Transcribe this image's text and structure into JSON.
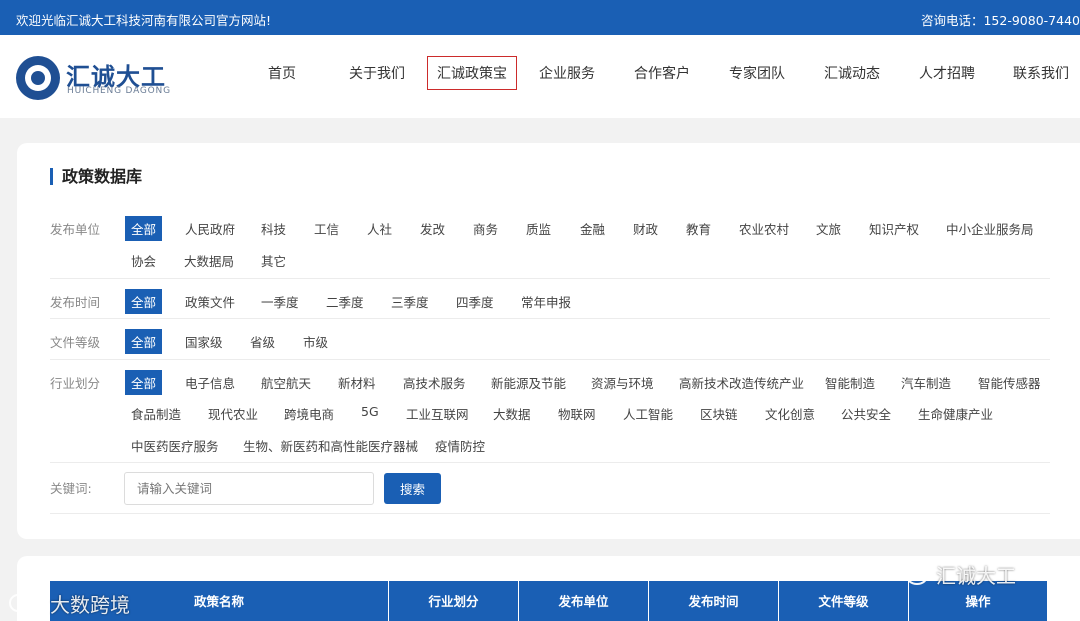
{
  "topbar": {
    "welcome": "欢迎光临汇诚大工科技河南有限公司官方网站!",
    "phone": "咨询电话：152-9080-7440"
  },
  "logo": {
    "name_cn": "汇诚大工",
    "name_en": "HUICHENG DAGONG"
  },
  "nav": [
    "首页",
    "关于我们",
    "汇诚政策宝",
    "企业服务",
    "合作客户",
    "专家团队",
    "汇诚动态",
    "人才招聘",
    "联系我们"
  ],
  "filter": {
    "title": "政策数据库",
    "publisher": {
      "label": "发布单位",
      "options": [
        "全部",
        "人民政府",
        "科技",
        "工信",
        "人社",
        "发改",
        "商务",
        "质监",
        "金融",
        "财政",
        "教育",
        "农业农村",
        "文旅",
        "知识产权",
        "中小企业服务局",
        "协会",
        "大数据局",
        "其它"
      ]
    },
    "time": {
      "label": "发布时间",
      "options": [
        "全部",
        "政策文件",
        "一季度",
        "二季度",
        "三季度",
        "四季度",
        "常年申报"
      ]
    },
    "level": {
      "label": "文件等级",
      "options": [
        "全部",
        "国家级",
        "省级",
        "市级"
      ]
    },
    "industry": {
      "label": "行业划分",
      "options": [
        "全部",
        "电子信息",
        "航空航天",
        "新材料",
        "高技术服务",
        "新能源及节能",
        "资源与环境",
        "高新技术改造传统产业",
        "智能制造",
        "汽车制造",
        "智能传感器",
        "食品制造",
        "现代农业",
        "跨境电商",
        "5G",
        "工业互联网",
        "大数据",
        "物联网",
        "人工智能",
        "区块链",
        "文化创意",
        "公共安全",
        "生命健康产业",
        "中医药医疗服务",
        "生物、新医药和高性能医疗器械",
        "疫情防控"
      ]
    },
    "keyword": {
      "label": "关键词:",
      "placeholder": "请输入关键词",
      "button": "搜索"
    }
  },
  "table": {
    "headers": [
      "政策名称",
      "行业划分",
      "发布单位",
      "发布时间",
      "文件等级",
      "操作"
    ]
  },
  "watermarks": {
    "left": "大数跨境",
    "right": "汇诚大工"
  },
  "colors": {
    "primary": "#1a5fb4",
    "highlight_box": "#cc2b2b",
    "page_bg": "#f2f2f2"
  }
}
